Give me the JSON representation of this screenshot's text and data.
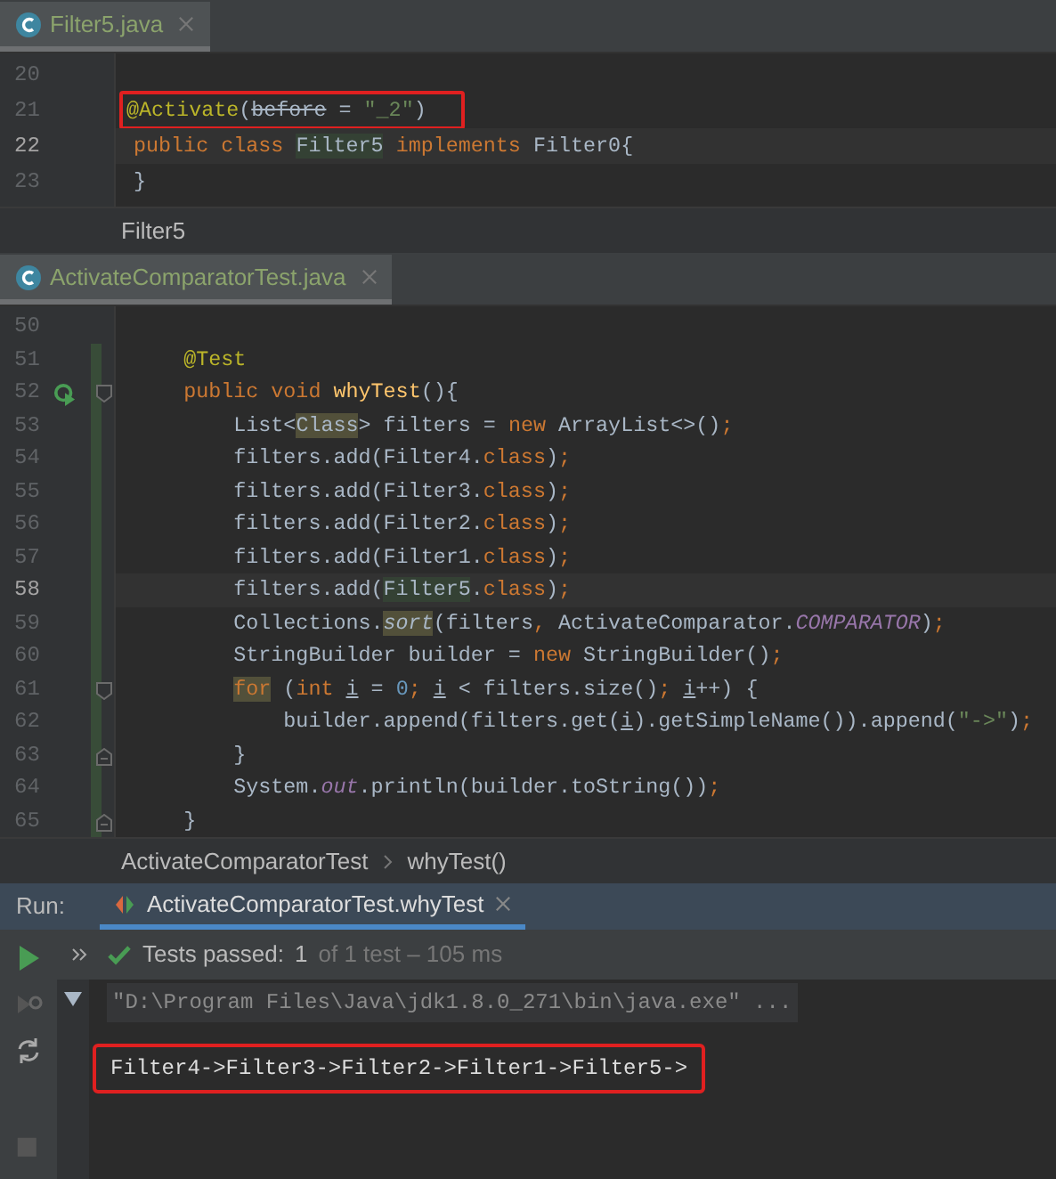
{
  "editors": [
    {
      "tab": {
        "label": "Filter5.java",
        "selected": true
      },
      "lines": [
        {
          "number": "20"
        },
        {
          "number": "21",
          "boxed": true,
          "tokens": [
            {
              "text": "@Activate",
              "kind": "a"
            },
            {
              "text": "(",
              "kind": "p"
            },
            {
              "text": "before",
              "kind": "x"
            },
            {
              "text": " = ",
              "kind": "p"
            },
            {
              "text": "\"_2\"",
              "kind": "s"
            },
            {
              "text": ")",
              "kind": "p"
            }
          ]
        },
        {
          "number": "22",
          "current": true,
          "tokens": [
            {
              "text": "public class ",
              "kind": "k"
            },
            {
              "text": "Filter5",
              "kind": "h"
            },
            {
              "text": " implements ",
              "kind": "k"
            },
            {
              "text": "Filter0{",
              "kind": "p"
            }
          ]
        },
        {
          "number": "23",
          "tokens": [
            {
              "text": "}",
              "kind": "p"
            }
          ]
        }
      ],
      "breadcrumbs": [
        "Filter5"
      ]
    },
    {
      "tab": {
        "label": "ActivateComparatorTest.java",
        "selected": true
      },
      "lines": [
        {
          "number": "50"
        },
        {
          "number": "51",
          "changed": true,
          "tokens": [
            {
              "text": "    @Test",
              "kind": "a"
            }
          ]
        },
        {
          "number": "52",
          "changed": true,
          "run_icon": true,
          "fold_start": true,
          "tokens": [
            {
              "text": "    public void ",
              "kind": "k"
            },
            {
              "text": "whyTest",
              "kind": "m"
            },
            {
              "text": "(){",
              "kind": "p"
            }
          ]
        },
        {
          "number": "53",
          "changed": true,
          "tokens": [
            {
              "text": "        List<",
              "kind": "p"
            },
            {
              "text": "Class",
              "kind": "t"
            },
            {
              "text": "> filters = ",
              "kind": "p"
            },
            {
              "text": "new ",
              "kind": "k"
            },
            {
              "text": "ArrayList<>()",
              "kind": "p"
            },
            {
              "text": ";",
              "kind": "k"
            }
          ]
        },
        {
          "number": "54",
          "changed": true,
          "tokens": [
            {
              "text": "        filters.add(Filter4.",
              "kind": "p"
            },
            {
              "text": "class",
              "kind": "k"
            },
            {
              "text": ")",
              "kind": "p"
            },
            {
              "text": ";",
              "kind": "k"
            }
          ]
        },
        {
          "number": "55",
          "changed": true,
          "tokens": [
            {
              "text": "        filters.add(Filter3.",
              "kind": "p"
            },
            {
              "text": "class",
              "kind": "k"
            },
            {
              "text": ")",
              "kind": "p"
            },
            {
              "text": ";",
              "kind": "k"
            }
          ]
        },
        {
          "number": "56",
          "changed": true,
          "tokens": [
            {
              "text": "        filters.add(Filter2.",
              "kind": "p"
            },
            {
              "text": "class",
              "kind": "k"
            },
            {
              "text": ")",
              "kind": "p"
            },
            {
              "text": ";",
              "kind": "k"
            }
          ]
        },
        {
          "number": "57",
          "changed": true,
          "tokens": [
            {
              "text": "        filters.add(Filter1.",
              "kind": "p"
            },
            {
              "text": "class",
              "kind": "k"
            },
            {
              "text": ")",
              "kind": "p"
            },
            {
              "text": ";",
              "kind": "k"
            }
          ]
        },
        {
          "number": "58",
          "changed": true,
          "current": true,
          "tokens": [
            {
              "text": "        filters.add(",
              "kind": "p"
            },
            {
              "text": "Filter5",
              "kind": "h"
            },
            {
              "text": ".",
              "kind": "p"
            },
            {
              "text": "class",
              "kind": "k"
            },
            {
              "text": ")",
              "kind": "p"
            },
            {
              "text": ";",
              "kind": "k"
            }
          ]
        },
        {
          "number": "59",
          "changed": true,
          "tokens": [
            {
              "text": "        Collections.",
              "kind": "p"
            },
            {
              "text": "sort",
              "kind": "si"
            },
            {
              "text": "(filters",
              "kind": "p"
            },
            {
              "text": ",",
              "kind": "k"
            },
            {
              "text": " ActivateComparator.",
              "kind": "p"
            },
            {
              "text": "COMPARATOR",
              "kind": "c"
            },
            {
              "text": ")",
              "kind": "p"
            },
            {
              "text": ";",
              "kind": "k"
            }
          ]
        },
        {
          "number": "60",
          "changed": true,
          "tokens": [
            {
              "text": "        StringBuilder builder = ",
              "kind": "p"
            },
            {
              "text": "new ",
              "kind": "k"
            },
            {
              "text": "StringBuilder()",
              "kind": "p"
            },
            {
              "text": ";",
              "kind": "k"
            }
          ]
        },
        {
          "number": "61",
          "changed": true,
          "fold_start": true,
          "tokens": [
            {
              "text": "        for",
              "kind": "kh"
            },
            {
              "text": " (",
              "kind": "p"
            },
            {
              "text": "int ",
              "kind": "k"
            },
            {
              "text": "i",
              "kind": "u"
            },
            {
              "text": " = ",
              "kind": "p"
            },
            {
              "text": "0",
              "kind": "n"
            },
            {
              "text": "; ",
              "kind": "k"
            },
            {
              "text": "i",
              "kind": "u"
            },
            {
              "text": " < filters.size()",
              "kind": "p"
            },
            {
              "text": "; ",
              "kind": "k"
            },
            {
              "text": "i",
              "kind": "u"
            },
            {
              "text": "++) {",
              "kind": "p"
            }
          ]
        },
        {
          "number": "62",
          "changed": true,
          "tokens": [
            {
              "text": "            builder.append(filters.get(",
              "kind": "p"
            },
            {
              "text": "i",
              "kind": "u"
            },
            {
              "text": ").getSimpleName()).append(",
              "kind": "p"
            },
            {
              "text": "\"->\"",
              "kind": "s"
            },
            {
              "text": ")",
              "kind": "p"
            },
            {
              "text": ";",
              "kind": "k"
            }
          ]
        },
        {
          "number": "63",
          "changed": true,
          "fold_end": true,
          "tokens": [
            {
              "text": "        }",
              "kind": "p"
            }
          ]
        },
        {
          "number": "64",
          "changed": true,
          "tokens": [
            {
              "text": "        System.",
              "kind": "p"
            },
            {
              "text": "out",
              "kind": "c"
            },
            {
              "text": ".println(builder.toString())",
              "kind": "p"
            },
            {
              "text": ";",
              "kind": "k"
            }
          ]
        },
        {
          "number": "65",
          "changed": true,
          "fold_end": true,
          "tokens": [
            {
              "text": "    }",
              "kind": "p"
            }
          ]
        }
      ],
      "breadcrumbs": [
        "ActivateComparatorTest",
        "whyTest()"
      ]
    }
  ],
  "run": {
    "label": "Run:",
    "tab": {
      "label": "ActivateComparatorTest.whyTest",
      "selected": true
    },
    "status": {
      "passed": "Tests passed:",
      "count": "1",
      "detail": "of 1 test – 105 ms"
    },
    "console": [
      {
        "kind": "command",
        "text": "\"D:\\Program Files\\Java\\jdk1.8.0_271\\bin\\java.exe\" ..."
      },
      {
        "kind": "output",
        "text": "Filter4->Filter3->Filter2->Filter1->Filter5->",
        "boxed": true
      }
    ]
  }
}
